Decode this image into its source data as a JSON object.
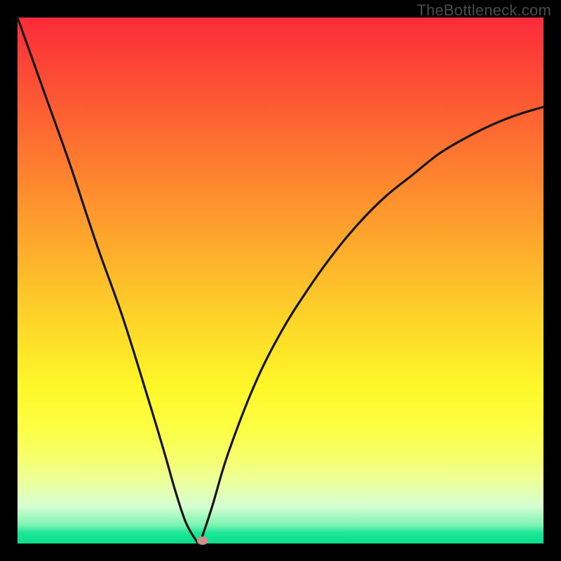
{
  "watermark": "TheBottleneck.com",
  "chart_data": {
    "type": "line",
    "title": "",
    "xlabel": "",
    "ylabel": "",
    "ylim": [
      0,
      100
    ],
    "x": [
      0.0,
      0.05,
      0.1,
      0.15,
      0.2,
      0.25,
      0.28,
      0.3,
      0.32,
      0.34,
      0.345,
      0.35,
      0.37,
      0.4,
      0.45,
      0.5,
      0.55,
      0.6,
      0.65,
      0.7,
      0.75,
      0.8,
      0.85,
      0.9,
      0.95,
      1.0
    ],
    "values": [
      100,
      86,
      72,
      57,
      43,
      27,
      17,
      10,
      4,
      0.5,
      0,
      1,
      7,
      17,
      30,
      40,
      48,
      55,
      61,
      66,
      70,
      74,
      77,
      79.5,
      81.5,
      83
    ],
    "minimum_point": {
      "x": 0.345,
      "y": 0
    },
    "marker": {
      "x_rel": 0.352,
      "color": "#cf8e88"
    },
    "background_gradient": {
      "top": "#fb2b3a",
      "bottom": "#05e08d"
    }
  }
}
